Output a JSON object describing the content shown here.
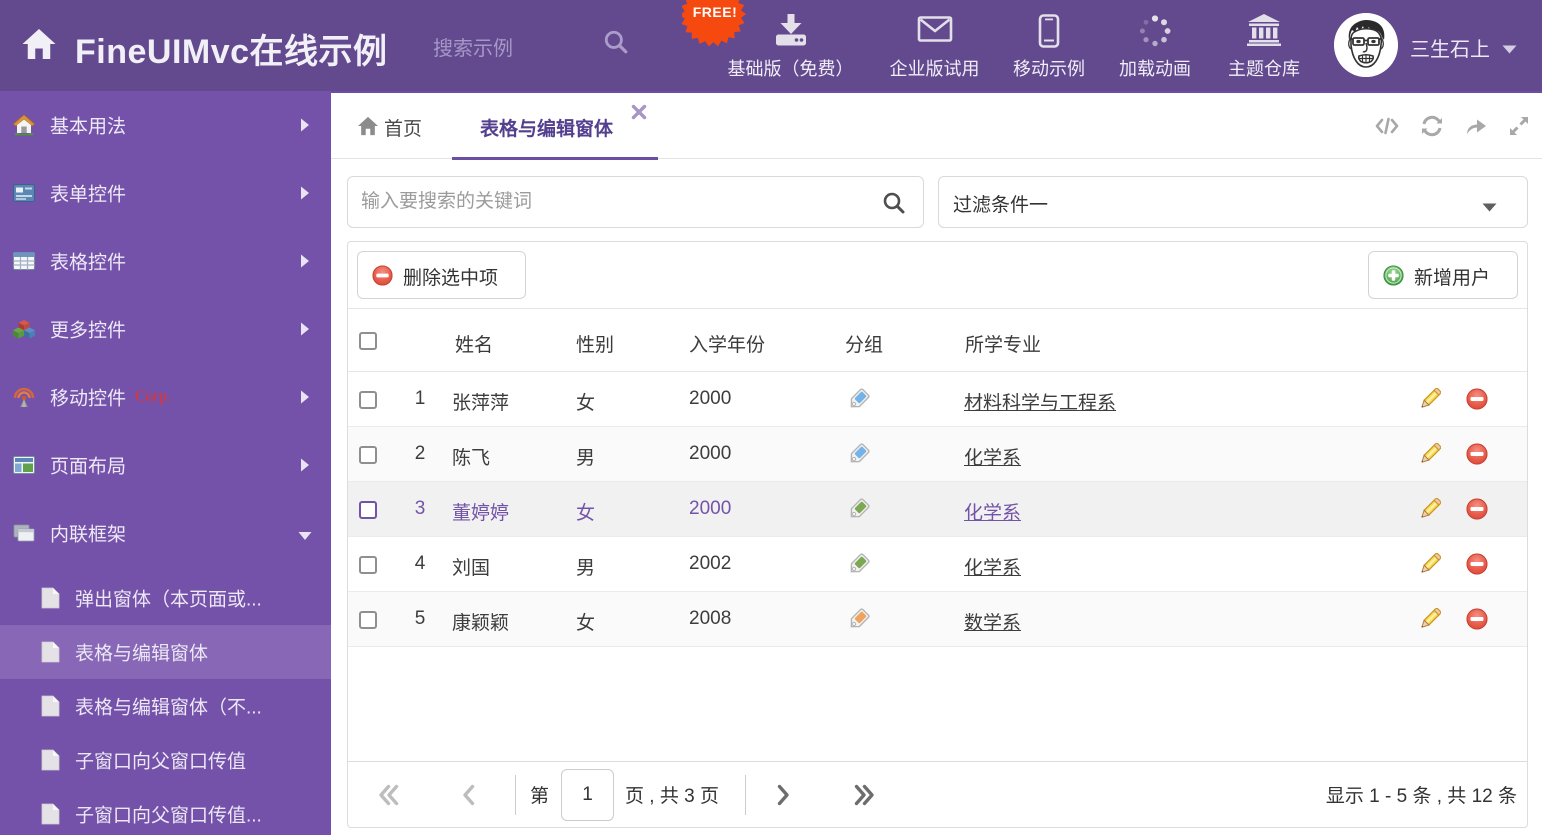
{
  "app": {
    "title": "FineUIMvc在线示例"
  },
  "header": {
    "search_placeholder": "搜索示例",
    "free_badge": "FREE!",
    "nav": [
      {
        "label": "基础版（免费）",
        "icon": "download-icon"
      },
      {
        "label": "企业版试用",
        "icon": "envelope-icon"
      },
      {
        "label": "移动示例",
        "icon": "mobile-icon"
      },
      {
        "label": "加载动画",
        "icon": "spinner-icon"
      },
      {
        "label": "主题仓库",
        "icon": "bank-icon"
      }
    ],
    "user": {
      "name": "三生石上"
    }
  },
  "sidebar": {
    "items": [
      {
        "label": "基本用法",
        "icon": "home-icon",
        "expanded": false
      },
      {
        "label": "表单控件",
        "icon": "form-icon",
        "expanded": false
      },
      {
        "label": "表格控件",
        "icon": "grid-icon",
        "expanded": false
      },
      {
        "label": "更多控件",
        "icon": "blocks-icon",
        "expanded": false
      },
      {
        "label": "移动控件",
        "icon": "signal-icon",
        "badge": "Corp.",
        "expanded": false
      },
      {
        "label": "页面布局",
        "icon": "layout-icon",
        "expanded": false
      },
      {
        "label": "内联框架",
        "icon": "frames-icon",
        "expanded": true
      }
    ],
    "subitems": [
      {
        "label": "弹出窗体（本页面或...",
        "active": false
      },
      {
        "label": "表格与编辑窗体",
        "active": true
      },
      {
        "label": "表格与编辑窗体（不...",
        "active": false
      },
      {
        "label": "子窗口向父窗口传值",
        "active": false
      },
      {
        "label": "子窗口向父窗口传值...",
        "active": false
      }
    ]
  },
  "tabs": {
    "home_label": "首页",
    "active_label": "表格与编辑窗体"
  },
  "filters": {
    "search_placeholder": "输入要搜索的关键词",
    "dropdown_value": "过滤条件一"
  },
  "toolbar": {
    "delete_label": "删除选中项",
    "add_label": "新增用户"
  },
  "table": {
    "columns": [
      "姓名",
      "性别",
      "入学年份",
      "分组",
      "所学专业"
    ],
    "rows": [
      {
        "index": "1",
        "name": "张萍萍",
        "gender": "女",
        "year": "2000",
        "tag_color": "blue",
        "major": "材料科学与工程系",
        "selected": false
      },
      {
        "index": "2",
        "name": "陈飞",
        "gender": "男",
        "year": "2000",
        "tag_color": "blue",
        "major": "化学系",
        "selected": false
      },
      {
        "index": "3",
        "name": "董婷婷",
        "gender": "女",
        "year": "2000",
        "tag_color": "green",
        "major": "化学系",
        "selected": true
      },
      {
        "index": "4",
        "name": "刘国",
        "gender": "男",
        "year": "2002",
        "tag_color": "green",
        "major": "化学系",
        "selected": false
      },
      {
        "index": "5",
        "name": "康颖颖",
        "gender": "女",
        "year": "2008",
        "tag_color": "orange",
        "major": "数学系",
        "selected": false
      }
    ]
  },
  "pagination": {
    "first_label": "第",
    "page": "1",
    "pages_label": "页 , 共 3 页",
    "summary": "显示 1 - 5 条 , 共 12 条"
  },
  "colors": {
    "header_bg": "#63498e",
    "sidebar_bg": "#7452aa",
    "sidebar_active_bg": "#8565b2",
    "accent_purple": "#6a4fa3",
    "free_badge_orange": "#f5490f",
    "corp_red": "#e8322c",
    "tag_blue": "#74b3e8",
    "tag_green": "#7ca853",
    "tag_orange": "#f0a35e",
    "delete_red": "#e2574c",
    "add_green": "#57a957",
    "selected_text": "#7353a7"
  }
}
